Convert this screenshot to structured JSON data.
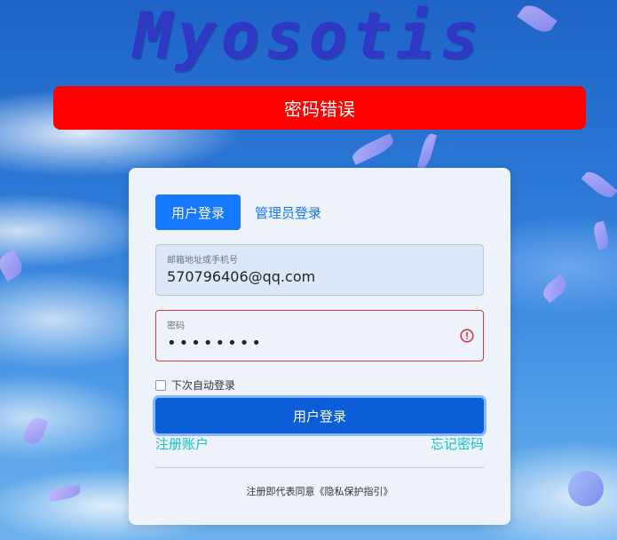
{
  "brand": "Myosotis",
  "alert": {
    "message": "密码错误"
  },
  "tabs": {
    "user_login": "用户登录",
    "admin_login": "管理员登录"
  },
  "email_field": {
    "label": "邮箱地址或手机号",
    "value": "570796406@qq.com"
  },
  "password_field": {
    "label": "密码",
    "value": "••••••••"
  },
  "remember": {
    "label": "下次自动登录"
  },
  "login_button": {
    "label": "用户登录"
  },
  "links": {
    "register": "注册账户",
    "forgot": "忘记密码"
  },
  "footer": {
    "text": "注册即代表同意《隐私保护指引》"
  },
  "colors": {
    "primary": "#1677ff",
    "error": "#ff0000",
    "link": "#13c2c2"
  },
  "icons": {
    "error": "exclamation-circle-icon"
  }
}
